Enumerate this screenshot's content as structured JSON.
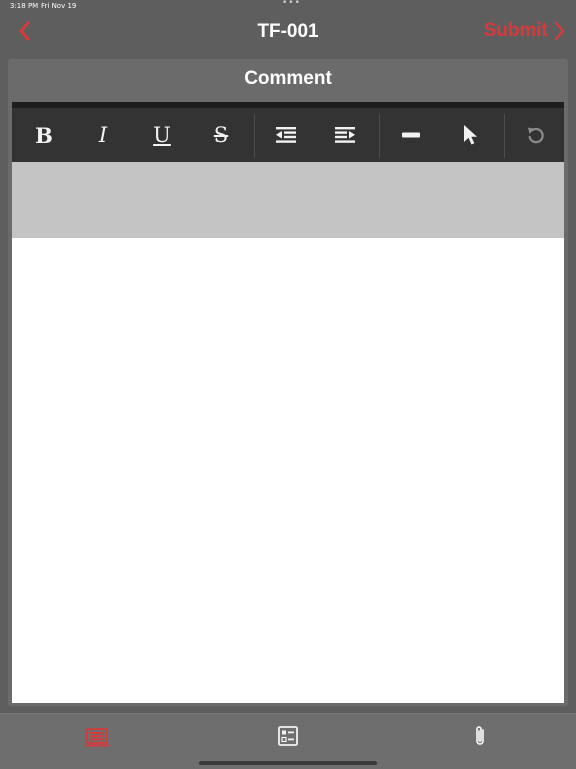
{
  "status_bar": {
    "time": "3:18 PM",
    "date": "Fri Nov 19",
    "dots": "•••"
  },
  "nav": {
    "back_icon": "chevron-left-icon",
    "title": "TF-001",
    "submit_label": "Submit",
    "accent": "#d73a3a"
  },
  "panel": {
    "title": "Comment"
  },
  "toolbar": {
    "bold": "B",
    "italic": "I",
    "underline": "U",
    "strikethrough": "S",
    "icons": [
      "outdent-icon",
      "indent-icon",
      "horizontal-rule-icon",
      "pointer-icon",
      "undo-icon"
    ]
  },
  "editor": {
    "content": ""
  },
  "tab_bar": {
    "icons": [
      "form-icon",
      "checklist-icon",
      "paperclip-icon"
    ],
    "active": "form-icon"
  }
}
